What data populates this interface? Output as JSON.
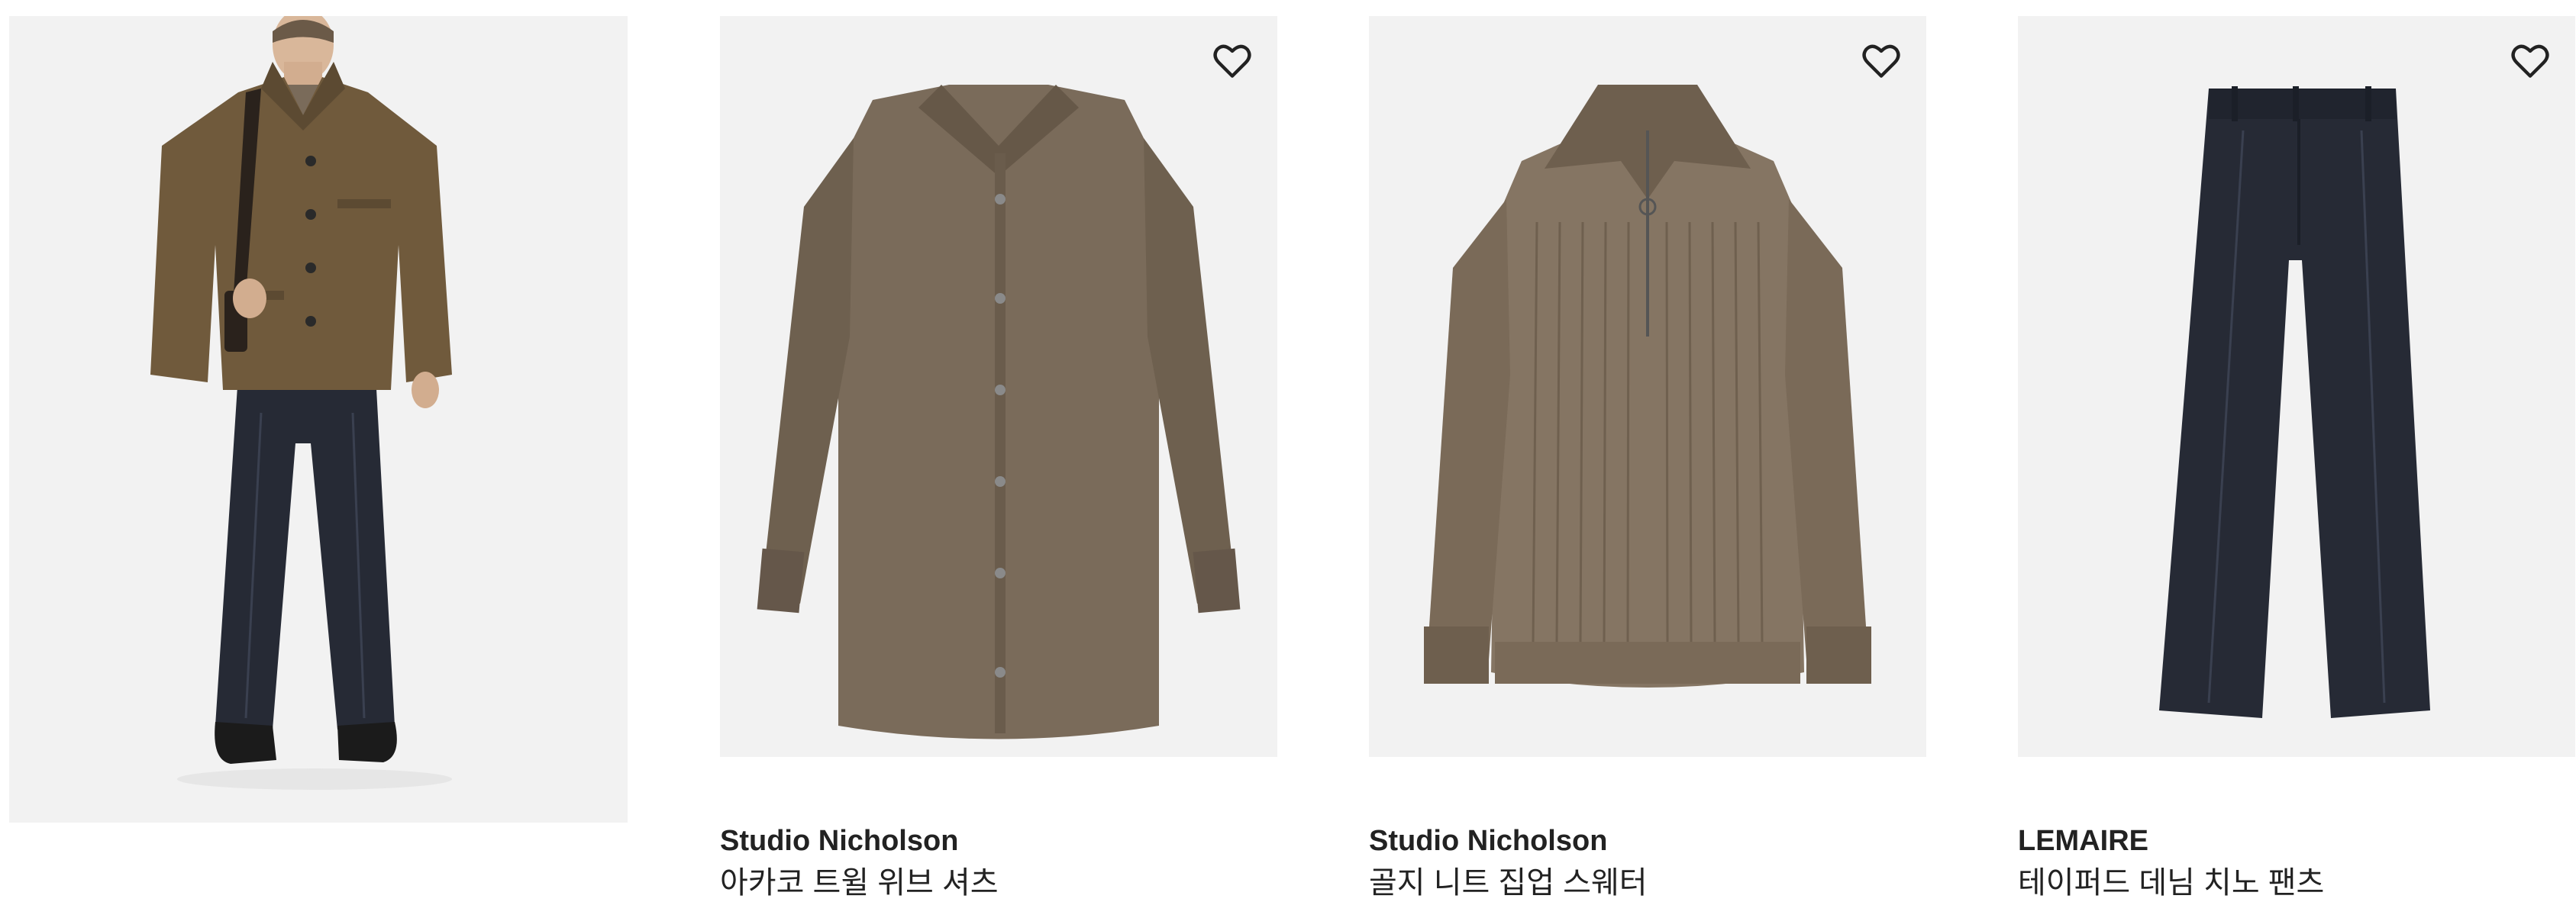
{
  "products": [
    {
      "brand": "Studio Nicholson",
      "name": "아카코 트윌 위브 셔츠",
      "color": "#7a6b5a",
      "wishlist_icon": "heart-icon"
    },
    {
      "brand": "Studio Nicholson",
      "name": "골지 니트 집업 스웨터",
      "color": "#857563",
      "wishlist_icon": "heart-icon"
    },
    {
      "brand": "LEMAIRE",
      "name": "테이퍼드 데님 치노 팬츠",
      "color": "#262a35",
      "wishlist_icon": "heart-icon"
    }
  ],
  "look": {
    "jacket_color": "#705a3c",
    "trouser_color": "#262a35"
  }
}
